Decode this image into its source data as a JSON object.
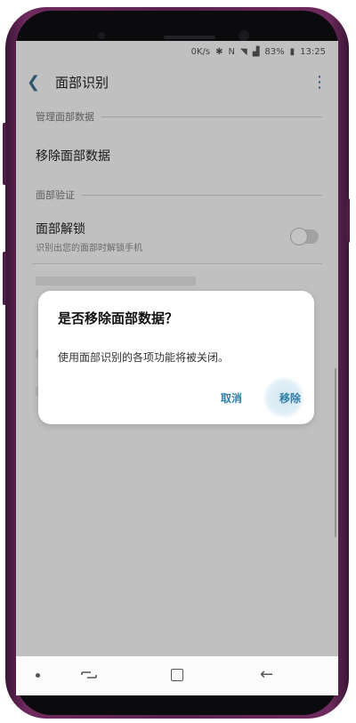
{
  "status_bar": {
    "speed": "0K/s",
    "battery": "83%",
    "time": "13:25"
  },
  "app_bar": {
    "title": "面部识别"
  },
  "sections": {
    "manage_header": "管理面部数据",
    "remove_item": "移除面部数据",
    "verify_header": "面部验证",
    "unlock_title": "面部解锁",
    "unlock_subtitle": "识别出您的面部时解锁手机"
  },
  "toggle": {
    "face_unlock_on": false
  },
  "dialog": {
    "title": "是否移除面部数据？",
    "message": "使用面部识别的各项功能将被关闭。",
    "cancel_label": "取消",
    "confirm_label": "移除"
  },
  "icons": {
    "back": "back-arrow-icon",
    "more": "more-vert-icon",
    "nav_recents": "recents-icon",
    "nav_home": "home-icon",
    "nav_back": "back-icon"
  },
  "colors": {
    "accent": "#2f7fa6",
    "phone_frame": "#5a2350"
  }
}
